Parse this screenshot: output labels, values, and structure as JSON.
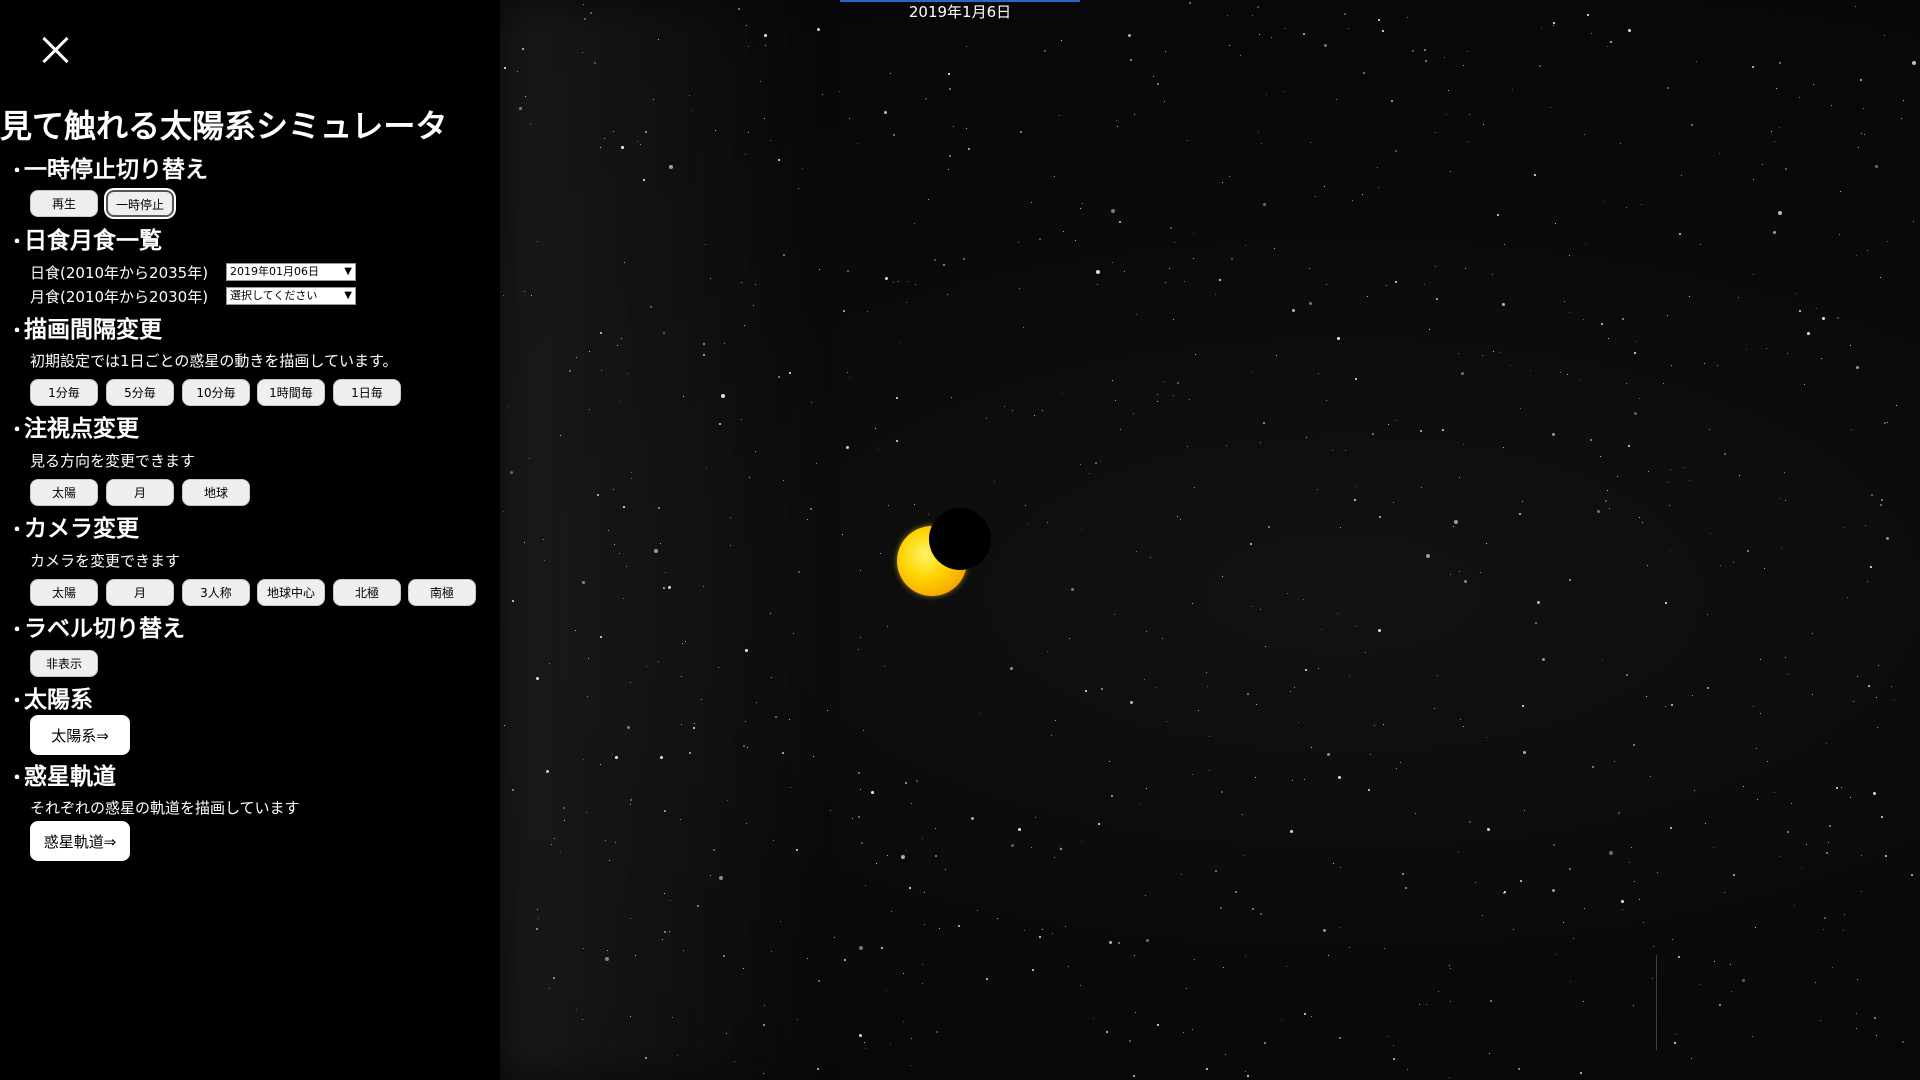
{
  "viewport": {
    "date": "2019年1月6日"
  },
  "panel": {
    "close_icon": "close-icon",
    "title": "見て触れる太陽系シミュレータ",
    "bullet": "・",
    "sections": {
      "pause": {
        "title": "一時停止切り替え",
        "buttons": [
          "再生",
          "一時停止"
        ],
        "selected": "一時停止"
      },
      "eclipse": {
        "title": "日食月食一覧",
        "solar_label": "日食(2010年から2035年)",
        "solar_value": "2019年01月06日",
        "lunar_label": "月食(2010年から2030年)",
        "lunar_value": "選択してください"
      },
      "interval": {
        "title": "描画間隔変更",
        "desc": "初期設定では1日ごとの惑星の動きを描画しています。",
        "buttons": [
          "1分毎",
          "5分毎",
          "10分毎",
          "1時間毎",
          "1日毎"
        ]
      },
      "target": {
        "title": "注視点変更",
        "desc": "見る方向を変更できます",
        "buttons": [
          "太陽",
          "月",
          "地球"
        ]
      },
      "camera": {
        "title": "カメラ変更",
        "desc": "カメラを変更できます",
        "buttons": [
          "太陽",
          "月",
          "3人称",
          "地球中心",
          "北極",
          "南極"
        ]
      },
      "label": {
        "title": "ラベル切り替え",
        "buttons": [
          "非表示"
        ]
      },
      "solar_system": {
        "title": "太陽系",
        "button": "太陽系⇒"
      },
      "orbit": {
        "title": "惑星軌道",
        "desc": "それぞれの惑星の軌道を描画しています",
        "button": "惑星軌道⇒"
      }
    }
  },
  "colors": {
    "sun": "#ffd400",
    "date_bar": "#2a64c8",
    "panel_bg": "#000000"
  }
}
